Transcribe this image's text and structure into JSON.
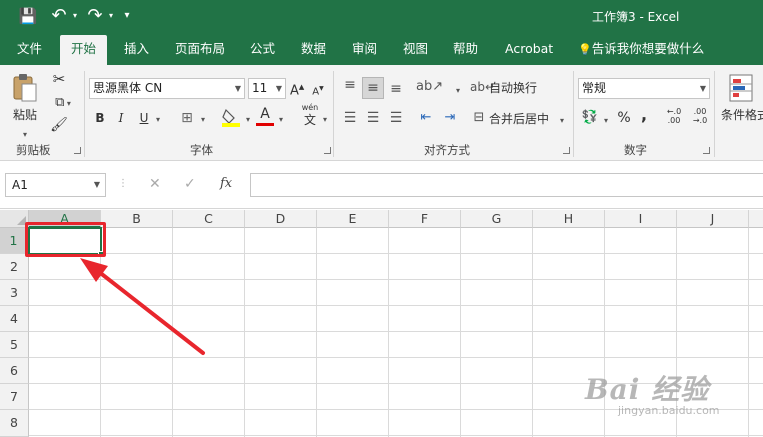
{
  "window": {
    "title": "工作簿3  -  Excel"
  },
  "qat": {
    "save_icon": "💾",
    "undo_icon": "↶",
    "redo_icon": "↷",
    "customize_icon": "▾"
  },
  "tabs": [
    {
      "label": "文件"
    },
    {
      "label": "开始"
    },
    {
      "label": "插入"
    },
    {
      "label": "页面布局"
    },
    {
      "label": "公式"
    },
    {
      "label": "数据"
    },
    {
      "label": "审阅"
    },
    {
      "label": "视图"
    },
    {
      "label": "帮助"
    },
    {
      "label": "Acrobat"
    }
  ],
  "tell_me": {
    "icon": "💡",
    "label": "告诉我你想要做什么"
  },
  "ribbon": {
    "clipboard": {
      "label": "剪贴板",
      "paste_label": "粘贴"
    },
    "font": {
      "label": "字体",
      "font_name": "思源黑体 CN",
      "font_size": "11",
      "grow": "A",
      "shrink": "A",
      "bold": "B",
      "italic": "I",
      "underline": "U",
      "font_color_letter": "A",
      "phonetic": "wén",
      "phonetic_char": "文"
    },
    "alignment": {
      "label": "对齐方式",
      "wrap_text": "自动换行",
      "merge_center": "合并后居中"
    },
    "number": {
      "label": "数字",
      "format": "常规",
      "percent": "%",
      "comma": ","
    },
    "styles": {
      "conditional_format": "条件格式"
    }
  },
  "formula_bar": {
    "name_box": "A1",
    "cancel": "✕",
    "enter": "✓",
    "fx": "fx",
    "value": ""
  },
  "grid": {
    "columns": [
      "A",
      "B",
      "C",
      "D",
      "E",
      "F",
      "G",
      "H",
      "I",
      "J"
    ],
    "rows": [
      "1",
      "2",
      "3",
      "4",
      "5",
      "6",
      "7",
      "8"
    ],
    "active_cell": "A1"
  },
  "annotation_color": "#e8262d",
  "accent_color": "#217346",
  "watermark": {
    "main": "Bai 经验",
    "sub": "jingyan.baidu.com"
  }
}
